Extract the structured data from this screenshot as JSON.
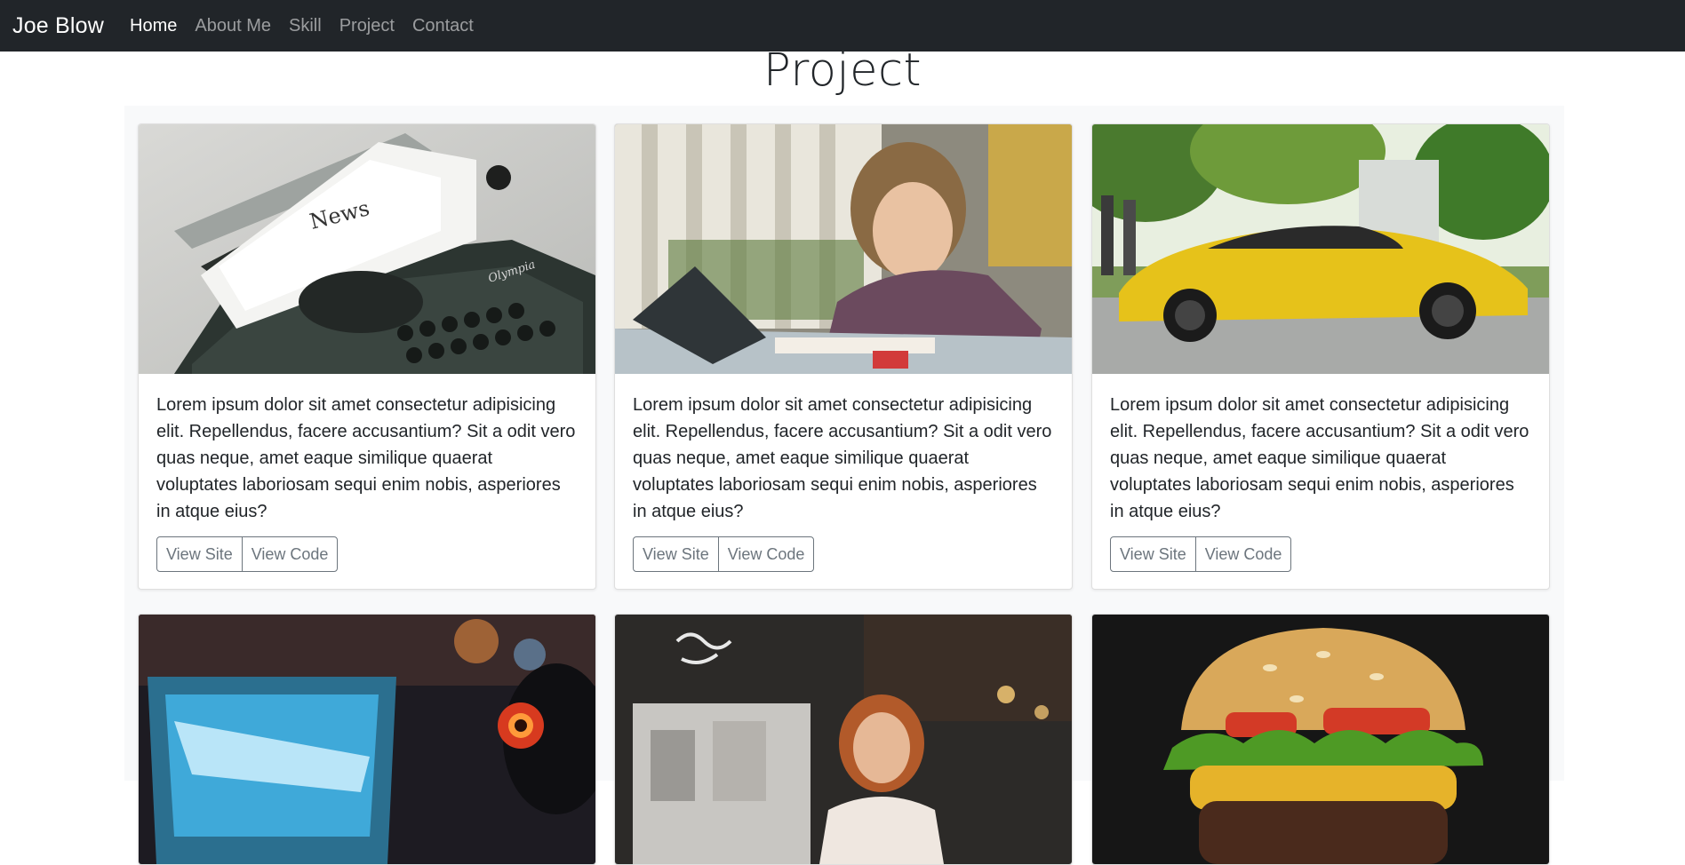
{
  "nav": {
    "brand": "Joe Blow",
    "items": [
      {
        "label": "Home",
        "active": true
      },
      {
        "label": "About Me",
        "active": false
      },
      {
        "label": "Skill",
        "active": false
      },
      {
        "label": "Project",
        "active": false
      },
      {
        "label": "Contact",
        "active": false
      }
    ]
  },
  "section": {
    "title": "Project"
  },
  "cards": [
    {
      "image": "typewriter-news-photo",
      "text": "Lorem ipsum dolor sit amet consectetur adipisicing elit. Repellendus, facere accusantium? Sit a odit vero quas neque, amet eaque similique quaerat voluptates laboriosam sequi enim nobis, asperiores in atque eius?",
      "view_site": "View Site",
      "view_code": "View Code"
    },
    {
      "image": "child-drawing-photo",
      "text": "Lorem ipsum dolor sit amet consectetur adipisicing elit. Repellendus, facere accusantium? Sit a odit vero quas neque, amet eaque similique quaerat voluptates laboriosam sequi enim nobis, asperiores in atque eius?",
      "view_site": "View Site",
      "view_code": "View Code"
    },
    {
      "image": "yellow-sports-car-photo",
      "text": "Lorem ipsum dolor sit amet consectetur adipisicing elit. Repellendus, facere accusantium? Sit a odit vero quas neque, amet eaque similique quaerat voluptates laboriosam sequi enim nobis, asperiores in atque eius?",
      "view_site": "View Site",
      "view_code": "View Code"
    },
    {
      "image": "gamer-headphones-photo"
    },
    {
      "image": "cafe-woman-photo"
    },
    {
      "image": "burger-photo"
    }
  ],
  "image_texts": {
    "typewriter_word": "News",
    "typewriter_brand": "Olympia"
  }
}
